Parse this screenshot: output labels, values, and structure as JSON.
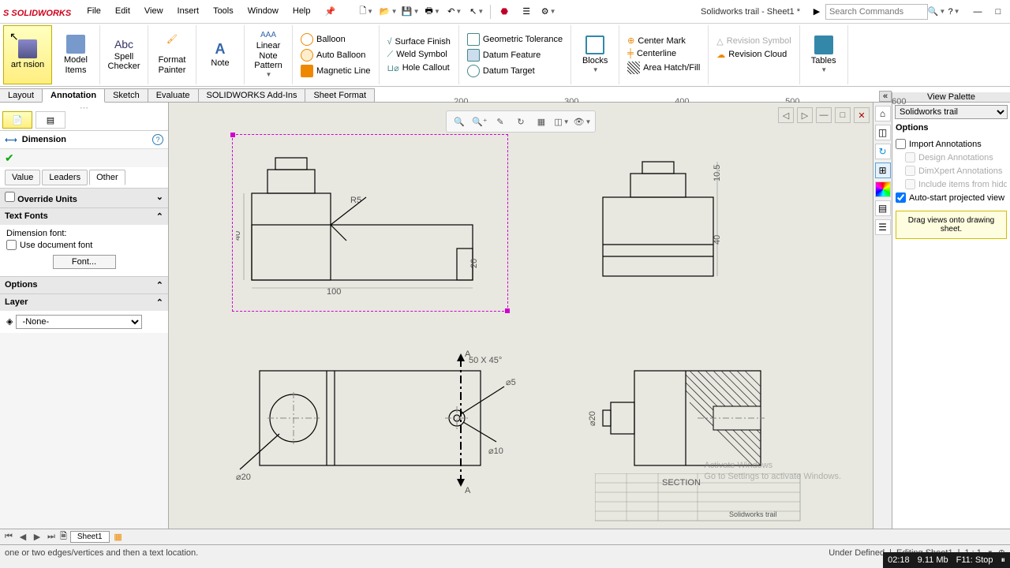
{
  "app": {
    "name": "SOLIDWORKS",
    "doc_title": "Solidworks trail - Sheet1 *"
  },
  "menu": [
    "File",
    "Edit",
    "View",
    "Insert",
    "Tools",
    "Window",
    "Help"
  ],
  "search": {
    "placeholder": "Search Commands"
  },
  "ribbon": {
    "smart_dim": "art nsion",
    "model_items": "Model Items",
    "spell": "Spell Checker",
    "format": "Format Painter",
    "note": "Note",
    "linear_note": "Linear Note Pattern",
    "balloon": "Balloon",
    "auto_balloon": "Auto Balloon",
    "magnetic": "Magnetic Line",
    "surface": "Surface Finish",
    "weld": "Weld Symbol",
    "hole": "Hole Callout",
    "geo_tol": "Geometric Tolerance",
    "datum_feat": "Datum Feature",
    "datum_target": "Datum Target",
    "blocks": "Blocks",
    "center_mark": "Center Mark",
    "centerline": "Centerline",
    "area_hatch": "Area Hatch/Fill",
    "rev_symbol": "Revision Symbol",
    "rev_cloud": "Revision Cloud",
    "tables": "Tables"
  },
  "tabs": [
    "Layout",
    "Annotation",
    "Sketch",
    "Evaluate",
    "SOLIDWORKS Add-Ins",
    "Sheet Format"
  ],
  "active_tab": "Annotation",
  "ruler_marks": {
    "200": "200",
    "300": "300",
    "400": "400",
    "500": "500",
    "600": "600"
  },
  "property": {
    "title": "Dimension",
    "sub_tabs": [
      "Value",
      "Leaders",
      "Other"
    ],
    "active_sub": "Other",
    "override_units": "Override Units",
    "text_fonts": "Text Fonts",
    "dim_font_label": "Dimension font:",
    "use_doc_font": "Use document font",
    "font_btn": "Font...",
    "options_sec": "Options",
    "layer_sec": "Layer",
    "layer_value": "-None-"
  },
  "right_panel": {
    "title": "View Palette",
    "dropdown": "Solidworks trail",
    "options_hdr": "Options",
    "import_anno": "Import Annotations",
    "design_anno": "Design Annotations",
    "dimxpert": "DimXpert Annotations",
    "include_hidden": "Include items from hidd",
    "auto_start": "Auto-start projected view",
    "drag_hint": "Drag views onto drawing sheet."
  },
  "canvas": {
    "dims": {
      "width100": "100",
      "height40": "40",
      "r5": "R5",
      "small20": "20",
      "h105": "10.5",
      "h40b": "40",
      "chamfer": "50 X 45°",
      "dia5": "⌀5",
      "dia10": "⌀10",
      "dia20": "⌀20",
      "dia20b": "⌀20",
      "section_label": "SECTION",
      "a1": "A",
      "a2": "A",
      "title_block": "Solidworks trail"
    }
  },
  "sheet_tab": "Sheet1",
  "status": {
    "hint": "one or two edges/vertices and then a text location.",
    "under_defined": "Under Defined",
    "editing": "Editing Sheet1",
    "scale": "1 : 1"
  },
  "taskbar": {
    "time": "02:18",
    "mem": "9.11 Mb",
    "rec": "F11: Stop"
  },
  "watermark": {
    "l1": "Activate Windows",
    "l2": "Go to Settings to activate Windows."
  }
}
